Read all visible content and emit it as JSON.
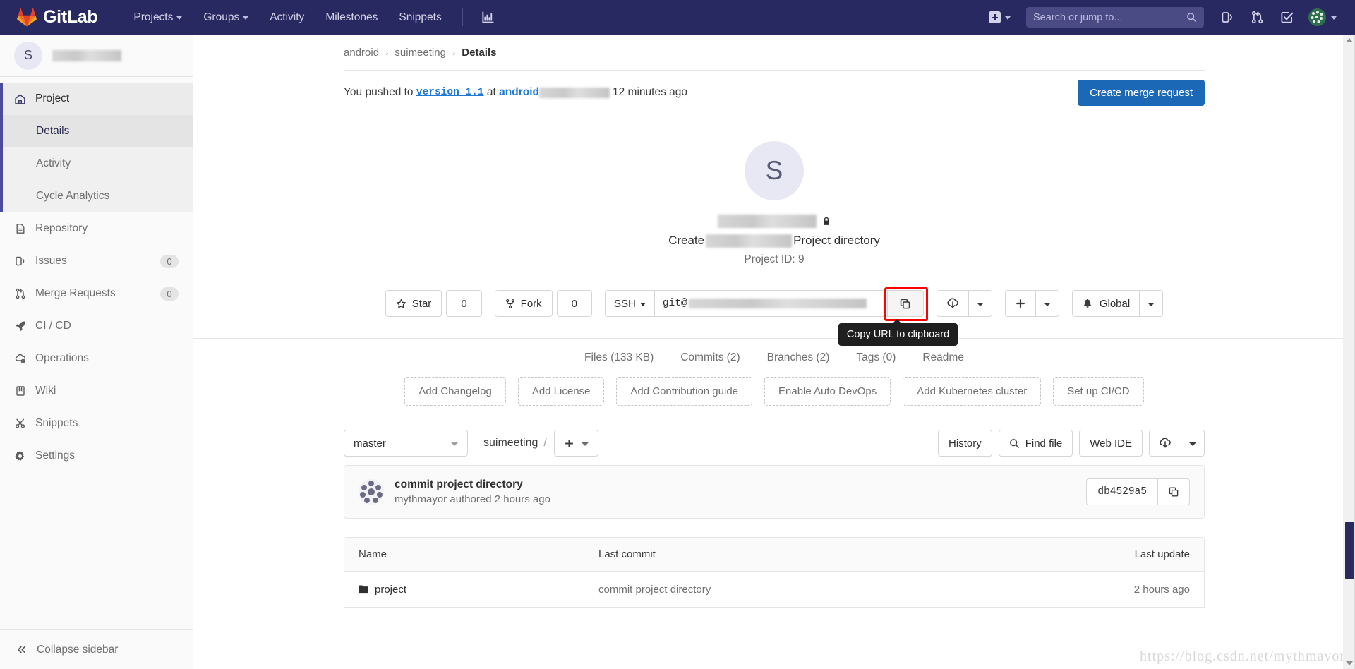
{
  "navbar": {
    "brand": "GitLab",
    "links": [
      {
        "label": "Projects",
        "has_caret": true
      },
      {
        "label": "Groups",
        "has_caret": true
      },
      {
        "label": "Activity",
        "has_caret": false
      },
      {
        "label": "Milestones",
        "has_caret": false
      },
      {
        "label": "Snippets",
        "has_caret": false
      }
    ],
    "chart_icon": "analytics-chart-icon",
    "new_icon": "plus-square-icon",
    "search_placeholder": "Search or jump to...",
    "search_value": "",
    "right_icons": [
      "issues-icon",
      "merge-requests-icon",
      "todos-checkmark-icon"
    ],
    "avatar_label": "user-avatar"
  },
  "sidebar": {
    "project_initial": "S",
    "project_name_redacted": true,
    "items": [
      {
        "label": "Project",
        "icon": "home-icon",
        "active": true,
        "badge": null
      },
      {
        "label": "Repository",
        "icon": "document-icon",
        "active": false,
        "badge": null
      },
      {
        "label": "Issues",
        "icon": "issues-icon",
        "active": false,
        "badge": "0"
      },
      {
        "label": "Merge Requests",
        "icon": "merge-request-icon",
        "active": false,
        "badge": "0"
      },
      {
        "label": "CI / CD",
        "icon": "rocket-icon",
        "active": false,
        "badge": null
      },
      {
        "label": "Operations",
        "icon": "cloud-gear-icon",
        "active": false,
        "badge": null
      },
      {
        "label": "Wiki",
        "icon": "book-icon",
        "active": false,
        "badge": null
      },
      {
        "label": "Snippets",
        "icon": "scissors-icon",
        "active": false,
        "badge": null
      },
      {
        "label": "Settings",
        "icon": "gear-icon",
        "active": false,
        "badge": null
      }
    ],
    "subitems": [
      {
        "label": "Details",
        "selected": true
      },
      {
        "label": "Activity",
        "selected": false
      },
      {
        "label": "Cycle Analytics",
        "selected": false
      }
    ],
    "collapse_label": "Collapse sidebar",
    "collapse_icon": "double-chevron-left-icon"
  },
  "breadcrumb": {
    "items": [
      "android",
      "suimeeting"
    ],
    "current": "Details",
    "separator": "›"
  },
  "push_notice": {
    "prefix": "You pushed to",
    "branch": "version_1.1",
    "at": "at",
    "project": "android",
    "project_redacted": true,
    "time": "12 minutes ago",
    "merge_request_button": "Create merge request"
  },
  "project": {
    "initial": "S",
    "name_redacted": true,
    "visibility_icon": "lock-icon",
    "description_prefix": "Create",
    "description_suffix": "Project directory",
    "project_id_label": "Project ID: 9"
  },
  "actions": {
    "star_label": "Star",
    "star_icon": "star-icon",
    "star_count": "0",
    "fork_label": "Fork",
    "fork_icon": "fork-icon",
    "fork_count": "0",
    "protocol": "SSH",
    "clone_url_prefix": "git@",
    "clone_url_redacted": true,
    "copy_icon": "copy-icon",
    "copy_tooltip": "Copy URL to clipboard",
    "download_icon": "download-icon",
    "plus_icon": "plus-icon",
    "notification_icon": "bell-icon",
    "notification_label": "Global"
  },
  "stats_nav": [
    "Files (133 KB)",
    "Commits (2)",
    "Branches (2)",
    "Tags (0)",
    "Readme"
  ],
  "quick_actions": [
    "Add Changelog",
    "Add License",
    "Add Contribution guide",
    "Enable Auto DevOps",
    "Add Kubernetes cluster",
    "Set up CI/CD"
  ],
  "file_toolbar": {
    "branch": "master",
    "path_root": "suimeeting",
    "path_slash": "/",
    "add_icon": "plus-icon",
    "history_label": "History",
    "find_file_label": "Find file",
    "find_file_icon": "search-icon",
    "web_ide_label": "Web IDE",
    "download_icon": "download-icon"
  },
  "last_commit": {
    "message": "commit project directory",
    "author_line": "mythmayor authored 2 hours ago",
    "sha": "db4529a5",
    "copy_icon": "copy-icon"
  },
  "file_table": {
    "headers": [
      "Name",
      "Last commit",
      "Last update"
    ],
    "rows": [
      {
        "name": "project",
        "icon": "folder-icon",
        "last_commit": "commit project directory",
        "last_update": "2 hours ago"
      }
    ]
  },
  "watermark": "https://blog.csdn.net/mythmayor",
  "colors": {
    "navbar_bg": "#292961",
    "accent": "#1b69b6",
    "highlight_red": "#ff0000",
    "sidebar_active": "#4b4b9e"
  }
}
